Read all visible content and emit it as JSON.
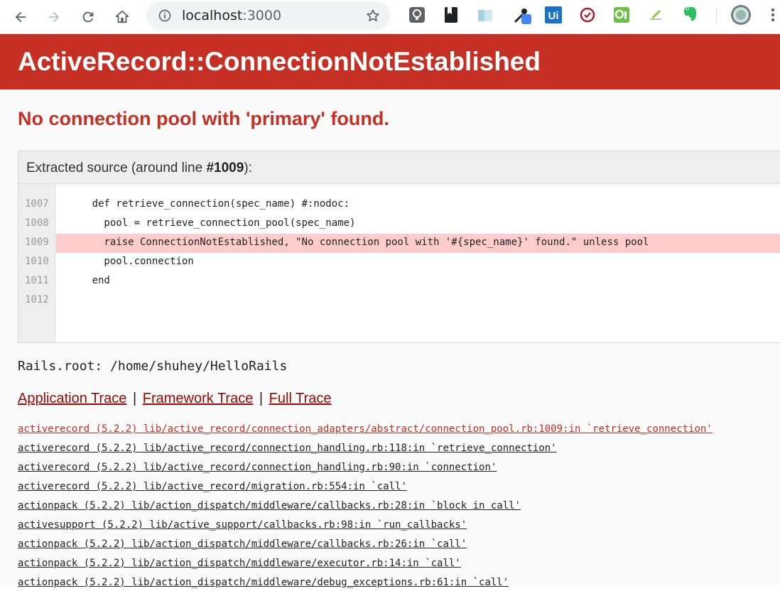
{
  "browser": {
    "url_host": "localhost",
    "url_port": ":3000"
  },
  "error": {
    "title": "ActiveRecord::ConnectionNotEstablished",
    "message": "No connection pool with 'primary' found."
  },
  "source": {
    "label_prefix": "Extracted source (around line ",
    "label_line": "#1009",
    "label_suffix": "):",
    "highlight_line": "1009",
    "lines": [
      {
        "n": "1007",
        "code": "      def retrieve_connection(spec_name) #:nodoc:"
      },
      {
        "n": "1008",
        "code": "        pool = retrieve_connection_pool(spec_name)"
      },
      {
        "n": "1009",
        "code": "        raise ConnectionNotEstablished, \"No connection pool with '#{spec_name}' found.\" unless pool"
      },
      {
        "n": "1010",
        "code": "        pool.connection"
      },
      {
        "n": "1011",
        "code": "      end"
      },
      {
        "n": "1012",
        "code": ""
      }
    ]
  },
  "rails_root": "Rails.root: /home/shuhey/HelloRails",
  "trace_tabs": {
    "application": "Application Trace",
    "framework": "Framework Trace",
    "full": "Full Trace",
    "separator": "|"
  },
  "traces": [
    "activerecord (5.2.2) lib/active_record/connection_adapters/abstract/connection_pool.rb:1009:in `retrieve_connection'",
    "activerecord (5.2.2) lib/active_record/connection_handling.rb:118:in `retrieve_connection'",
    "activerecord (5.2.2) lib/active_record/connection_handling.rb:90:in `connection'",
    "activerecord (5.2.2) lib/active_record/migration.rb:554:in `call'",
    "actionpack (5.2.2) lib/action_dispatch/middleware/callbacks.rb:28:in `block in call'",
    "activesupport (5.2.2) lib/active_support/callbacks.rb:98:in `run_callbacks'",
    "actionpack (5.2.2) lib/action_dispatch/middleware/callbacks.rb:26:in `call'",
    "actionpack (5.2.2) lib/action_dispatch/middleware/executor.rb:14:in `call'",
    "actionpack (5.2.2) lib/action_dispatch/middleware/debug_exceptions.rb:61:in `call'"
  ],
  "colors": {
    "header_red": "#c52f24",
    "link_red": "#980905",
    "highlight": "#ffcccc"
  }
}
